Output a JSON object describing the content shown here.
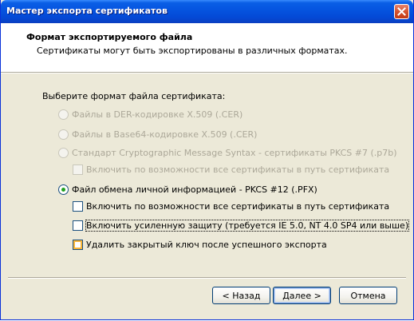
{
  "window": {
    "title": "Мастер экспорта сертификатов"
  },
  "header": {
    "title": "Формат экспортируемого файла",
    "description": "Сертификаты могут быть экспортированы в различных форматах."
  },
  "section_label": "Выберите формат файла сертификата:",
  "options": {
    "der": "Файлы в DER-кодировке X.509 (.CER)",
    "base64": "Файлы в Base64-кодировке X.509 (.CER)",
    "pkcs7": "Стандарт Cryptographic Message Syntax - сертификаты PKCS #7 (.p7b)",
    "pkcs7_include": "Включить по возможности все сертификаты в путь сертификата",
    "pfx": "Файл обмена личной информацией - PKCS #12 (.PFX)",
    "pfx_include": "Включить по возможности все сертификаты в путь сертификата",
    "pfx_strong": "Включить усиленную защиту (требуется IE 5.0, NT 4.0 SP4 или выше)",
    "pfx_delete": "Удалить закрытый ключ после успешного экспорта"
  },
  "buttons": {
    "back": "< Назад",
    "next": "Далее >",
    "cancel": "Отмена"
  }
}
